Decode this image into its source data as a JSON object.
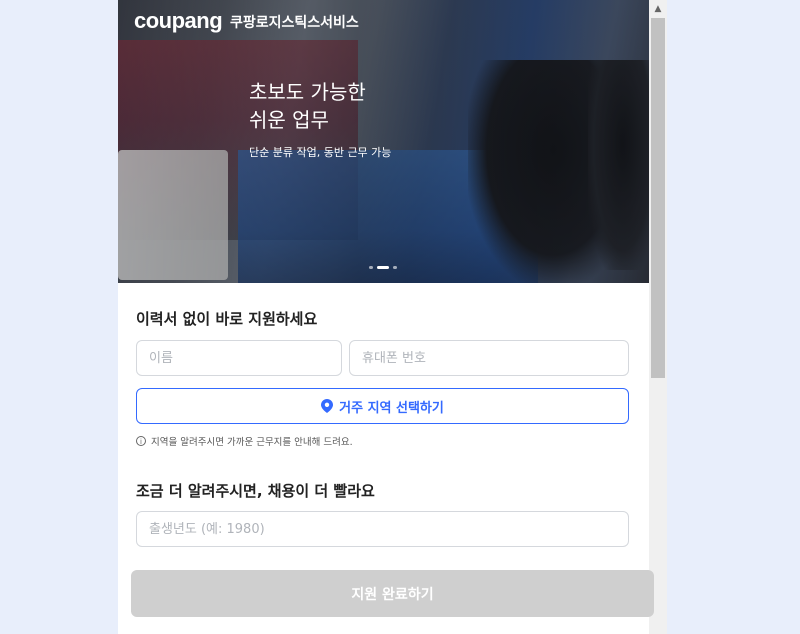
{
  "header": {
    "logo": "coupang",
    "brand": "쿠팡로지스틱스서비스"
  },
  "hero": {
    "headline_line1": "초보도 가능한",
    "headline_line2": "쉬운 업무",
    "subline": "단순 분류 작업, 동반 근무 가능",
    "slide_indicator": {
      "count": 3,
      "active_index": 1
    }
  },
  "form": {
    "section1_title": "이력서 없이 바로 지원하세요",
    "name_placeholder": "이름",
    "phone_placeholder": "휴대폰 번호",
    "region_button_label": "거주 지역 선택하기",
    "region_icon": "map-pin-icon",
    "region_notice": "지역을 알려주시면 가까운 근무지를 안내해 드려요.",
    "section2_title": "조금 더 알려주시면, 채용이 더 빨라요",
    "birth_year_placeholder": "출생년도 (예: 1980)",
    "submit_label": "지원 완료하기"
  },
  "colors": {
    "accent": "#346aff",
    "submit_disabled": "#cfcfcf",
    "page_bg": "#e8eefb"
  }
}
